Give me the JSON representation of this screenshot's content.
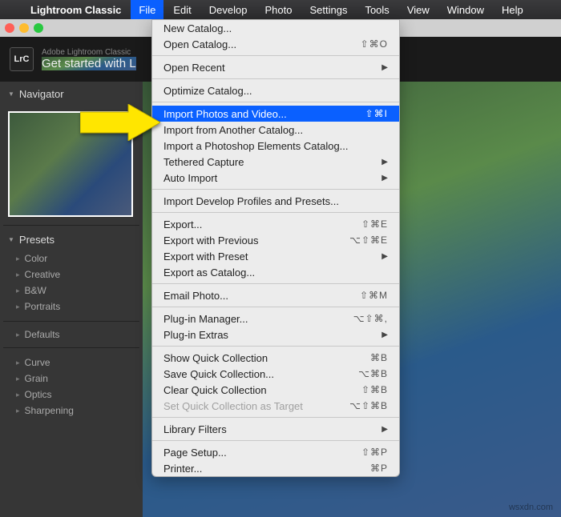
{
  "menubar": {
    "apple": "",
    "app": "Lightroom Classic",
    "items": [
      "File",
      "Edit",
      "Develop",
      "Photo",
      "Settings",
      "Tools",
      "View",
      "Window",
      "Help"
    ]
  },
  "header": {
    "logo": "LrC",
    "subtitle": "Adobe Lightroom Classic",
    "title": "Get started with L"
  },
  "sidebar": {
    "navigator": "Navigator",
    "presets": "Presets",
    "preset_items": [
      "Color",
      "Creative",
      "B&W",
      "Portraits"
    ],
    "defaults": "Defaults",
    "extra_items": [
      "Curve",
      "Grain",
      "Optics",
      "Sharpening"
    ]
  },
  "menu": {
    "new_catalog": "New Catalog...",
    "open_catalog": "Open Catalog...",
    "open_catalog_s": "⇧⌘O",
    "open_recent": "Open Recent",
    "optimize": "Optimize Catalog...",
    "import_pv": "Import Photos and Video...",
    "import_pv_s": "⇧⌘I",
    "import_cat": "Import from Another Catalog...",
    "import_pse": "Import a Photoshop Elements Catalog...",
    "tethered": "Tethered Capture",
    "auto_import": "Auto Import",
    "import_dev": "Import Develop Profiles and Presets...",
    "export": "Export...",
    "export_s": "⇧⌘E",
    "export_prev": "Export with Previous",
    "export_prev_s": "⌥⇧⌘E",
    "export_preset": "Export with Preset",
    "export_cat": "Export as Catalog...",
    "email": "Email Photo...",
    "email_s": "⇧⌘M",
    "plugin_mgr": "Plug-in Manager...",
    "plugin_mgr_s": "⌥⇧⌘,",
    "plugin_ext": "Plug-in Extras",
    "show_qc": "Show Quick Collection",
    "show_qc_s": "⌘B",
    "save_qc": "Save Quick Collection...",
    "save_qc_s": "⌥⌘B",
    "clear_qc": "Clear Quick Collection",
    "clear_qc_s": "⇧⌘B",
    "set_qc": "Set Quick Collection as Target",
    "set_qc_s": "⌥⇧⌘B",
    "lib_filters": "Library Filters",
    "page_setup": "Page Setup...",
    "page_setup_s": "⇧⌘P",
    "printer": "Printer...",
    "printer_s": "⌘P"
  },
  "watermark": "wsxdn.com"
}
